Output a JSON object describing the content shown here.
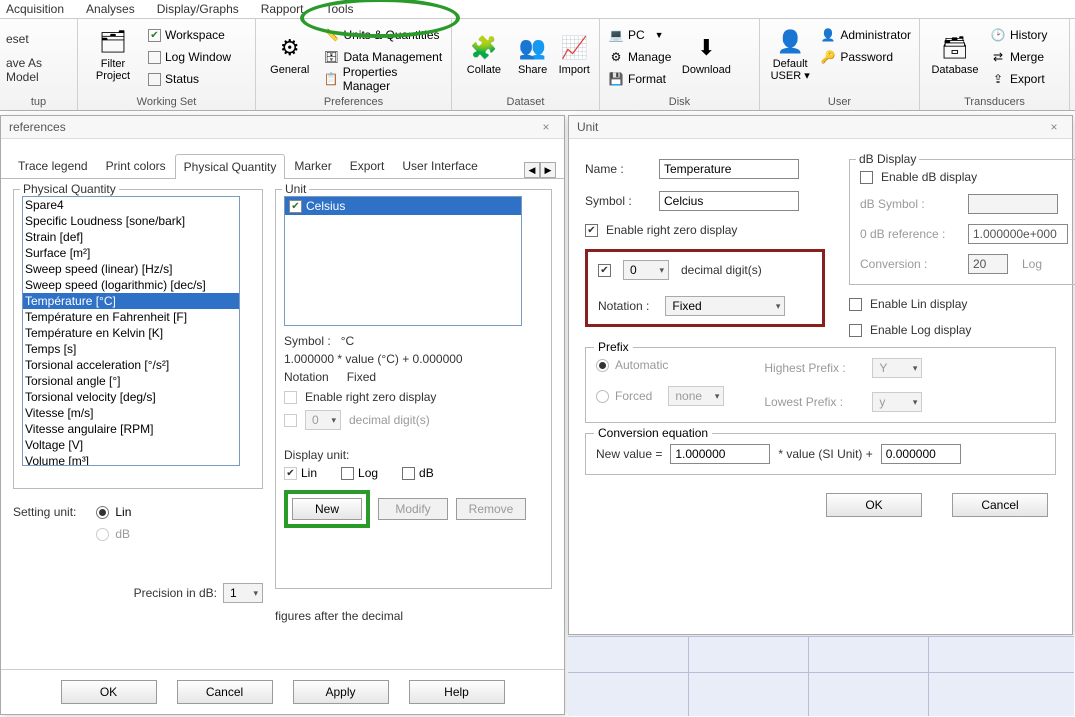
{
  "menubar": [
    "Acquisition",
    "Analyses",
    "Display/Graphs",
    "Rapport",
    "Tools"
  ],
  "ribbon": {
    "groups": [
      {
        "label": "tup",
        "items": [
          {
            "t": "small",
            "text": "eset"
          },
          {
            "t": "small",
            "text": "ave As Model"
          }
        ]
      },
      {
        "label": "Working Set",
        "big": {
          "text": "Filter\nProject",
          "icon": "📁"
        },
        "rows": [
          {
            "icon": "☑",
            "text": "Workspace",
            "checked": true
          },
          {
            "icon": "☐",
            "text": "Log Window",
            "checked": false
          },
          {
            "icon": "☐",
            "text": "Status",
            "checked": false
          }
        ]
      },
      {
        "label": "Preferences",
        "big": {
          "text": "General",
          "icon": "⚙"
        },
        "rows": [
          {
            "icon": "📏",
            "text": "Units & Quantities"
          },
          {
            "icon": "🗄",
            "text": "Data Management"
          },
          {
            "icon": "📋",
            "text": "Properties Manager"
          }
        ]
      },
      {
        "label": "Dataset",
        "bigs": [
          {
            "text": "Collate",
            "icon": "🔗"
          },
          {
            "text": "Share",
            "icon": "👥"
          },
          {
            "text": "Import",
            "icon": "📈"
          }
        ]
      },
      {
        "label": "Disk",
        "rows": [
          {
            "icon": "💻",
            "text": "PC",
            "drop": true
          },
          {
            "icon": "⚙",
            "text": "Manage"
          },
          {
            "icon": "🗂",
            "text": "Format"
          }
        ],
        "big": {
          "text": "Download",
          "icon": "⬇"
        }
      },
      {
        "label": "User",
        "big": {
          "text": "Default\nUSER ▾",
          "icon": "👤"
        },
        "rows": [
          {
            "icon": "👤",
            "text": "Administrator"
          },
          {
            "icon": "🔑",
            "text": "Password"
          }
        ]
      },
      {
        "label": "Transducers",
        "big": {
          "text": "Database",
          "icon": "🗃"
        },
        "rows": [
          {
            "icon": "🕑",
            "text": "History"
          },
          {
            "icon": "⇄",
            "text": "Merge"
          },
          {
            "icon": "⇪",
            "text": "Export"
          }
        ]
      }
    ]
  },
  "pref": {
    "title": "references",
    "tabs": [
      "Trace legend",
      "Print colors",
      "Physical Quantity",
      "Marker",
      "Export",
      "User Interface"
    ],
    "activeTab": "Physical Quantity",
    "pq_legend": "Physical Quantity",
    "pq_list": [
      "Spare4",
      "Specific Loudness [sone/bark]",
      "Strain [def]",
      "Surface [m²]",
      "Sweep speed (linear) [Hz/s]",
      "Sweep speed (logarithmic) [dec/s]",
      "Température [°C]",
      "Température en Fahrenheit [F]",
      "Température en Kelvin [K]",
      "Temps [s]",
      "Torsional acceleration [°/s²]",
      "Torsional angle [°]",
      "Torsional velocity [deg/s]",
      "Vitesse [m/s]",
      "Vitesse angulaire [RPM]",
      "Voltage [V]",
      "Volume [m³]"
    ],
    "pq_selected": "Température [°C]",
    "setting_unit": "Setting unit:",
    "setting_lin": "Lin",
    "setting_db": "dB",
    "unit_legend": "Unit",
    "unit_item": "Celsius",
    "symbol_lbl": "Symbol :",
    "symbol_val": "°C",
    "formula": "1.000000 * value (°C) + 0.000000",
    "notation_lbl": "Notation",
    "notation_val": "Fixed",
    "enable_zero": "Enable right zero display",
    "decimal_val": "0",
    "decimal_after": "decimal digit(s)",
    "display_unit": "Display unit:",
    "du_lin": "Lin",
    "du_log": "Log",
    "du_db": "dB",
    "new": "New",
    "modify": "Modify",
    "remove": "Remove",
    "precision_lbl": "Precision in dB:",
    "precision_val": "1",
    "precision_after": "figures after the decimal",
    "ok": "OK",
    "cancel": "Cancel",
    "apply": "Apply",
    "help": "Help"
  },
  "unit": {
    "title": "Unit",
    "name_lbl": "Name :",
    "name_val": "Temperature",
    "symbol_lbl": "Symbol :",
    "symbol_val": "Celcius",
    "enable_zero": "Enable right zero display",
    "decimal_val": "0",
    "decimal_after": "decimal digit(s)",
    "notation_lbl": "Notation :",
    "notation_val": "Fixed",
    "db_legend": "dB Display",
    "enable_db": "Enable dB display",
    "db_sym_lbl": "dB Symbol :",
    "db_sym_val": "",
    "ref_lbl": "0 dB reference :",
    "ref_val": "1.000000e+000",
    "conv_lbl": "Conversion :",
    "conv_val": "20",
    "conv_log": "Log",
    "enable_lin": "Enable Lin display",
    "enable_log": "Enable Log display",
    "prefix_legend": "Prefix",
    "auto": "Automatic",
    "forced": "Forced",
    "none": "none",
    "hi": "Highest Prefix :",
    "hi_v": "Y",
    "lo": "Lowest Prefix :",
    "lo_v": "y",
    "conv_legend": "Conversion equation",
    "newval": "New value =",
    "mult": "1.000000",
    "star": "* value (SI Unit) +",
    "add": "0.000000",
    "ok": "OK",
    "cancel": "Cancel"
  }
}
